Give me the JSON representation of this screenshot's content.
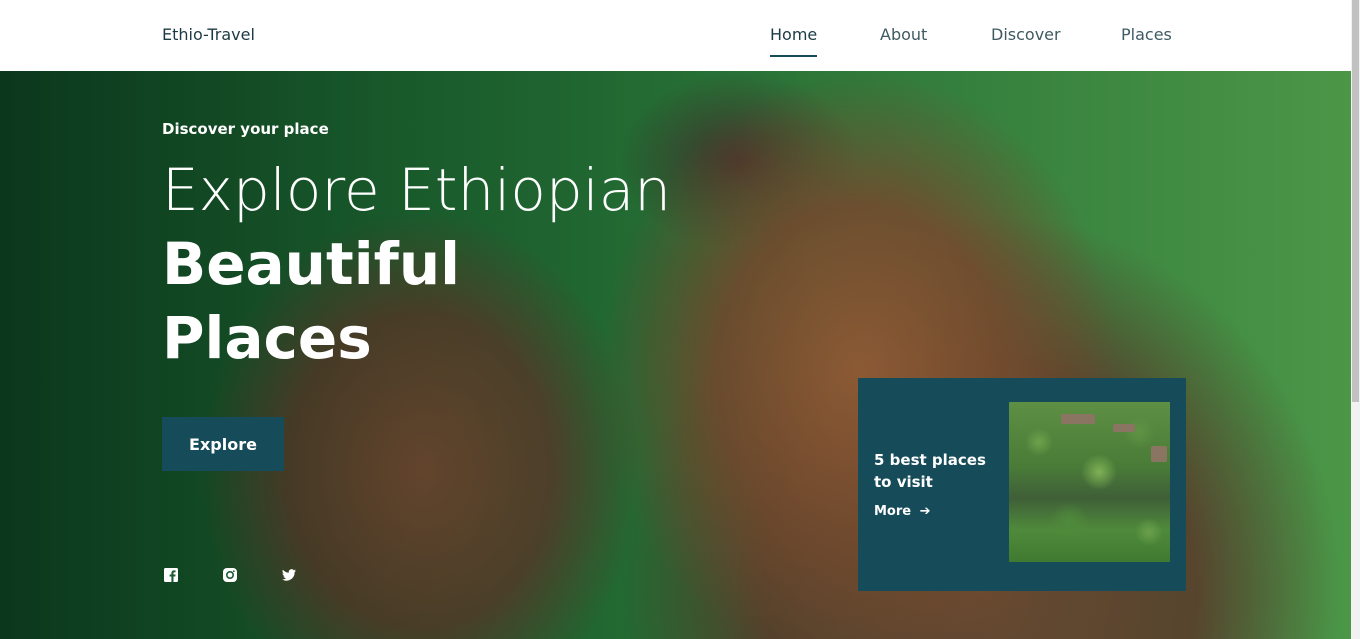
{
  "header": {
    "brand": "Ethio-Travel",
    "nav": [
      {
        "label": "Home",
        "active": true
      },
      {
        "label": "About",
        "active": false
      },
      {
        "label": "Discover",
        "active": false
      },
      {
        "label": "Places",
        "active": false
      }
    ]
  },
  "hero": {
    "eyebrow": "Discover your place",
    "headline_line1": "Explore Ethiopian",
    "headline_line2": "Beautiful",
    "headline_line3": "Places",
    "explore_label": "Explore",
    "socials": [
      "facebook-icon",
      "instagram-icon",
      "twitter-icon"
    ]
  },
  "card": {
    "title": "5 best places to visit",
    "more_label": "More",
    "more_icon": "arrow-right-icon"
  },
  "colors": {
    "accent": "#164b5a",
    "brand_text": "#1c3a46"
  }
}
